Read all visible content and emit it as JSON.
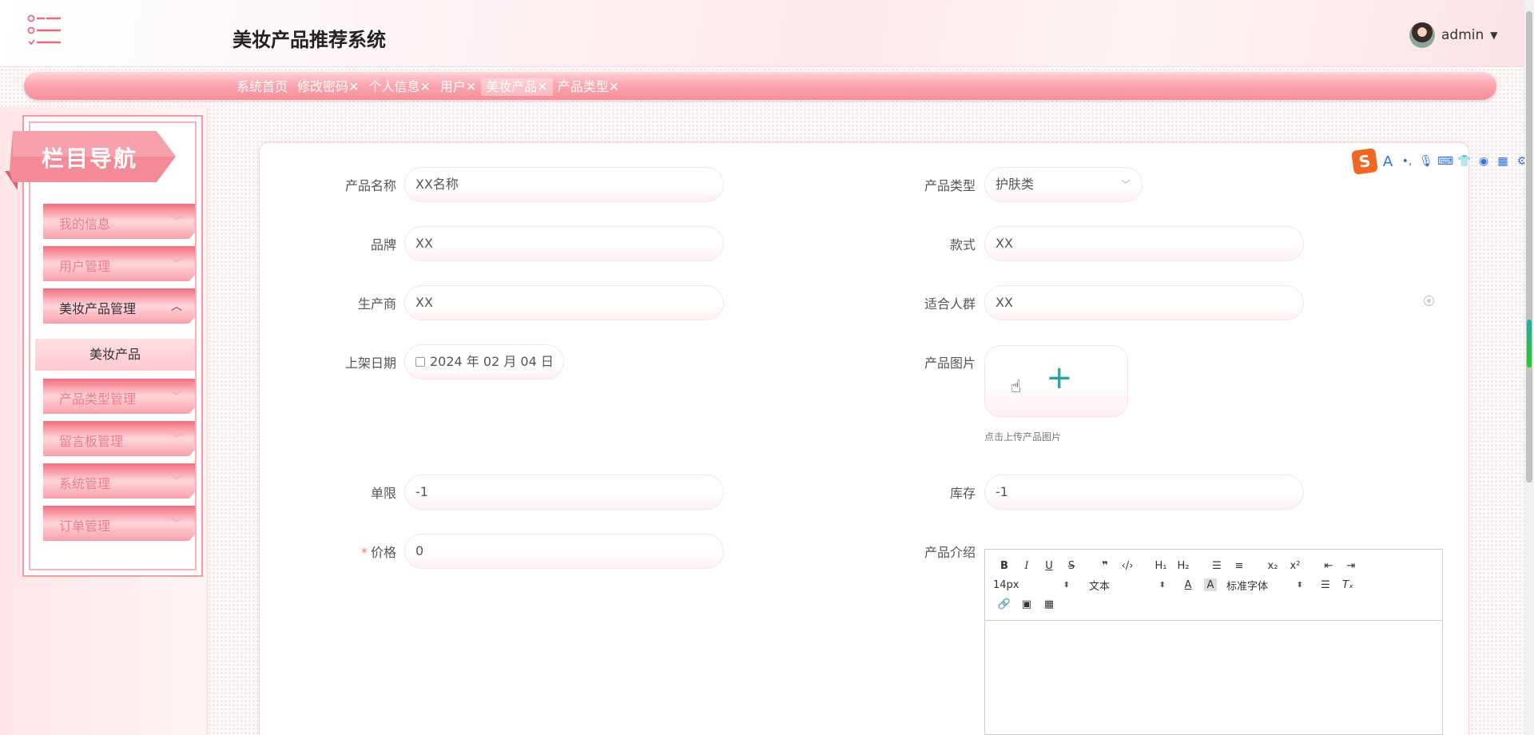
{
  "header": {
    "title": "美妆产品推荐系统",
    "user": "admin"
  },
  "tabs": [
    {
      "label": "系统首页"
    },
    {
      "label": "修改密码✕"
    },
    {
      "label": "个人信息✕"
    },
    {
      "label": "用户✕"
    },
    {
      "label": "美妆产品✕"
    },
    {
      "label": "产品类型✕"
    }
  ],
  "sidebar": {
    "banner": "栏目导航",
    "items": [
      {
        "label": "我的信息"
      },
      {
        "label": "用户管理"
      },
      {
        "label": "美妆产品管理"
      },
      {
        "label": "产品类型管理"
      },
      {
        "label": "留言板管理"
      },
      {
        "label": "系统管理"
      },
      {
        "label": "订单管理"
      }
    ],
    "sub_active": "美妆产品"
  },
  "form": {
    "name_label": "产品名称",
    "name_value": "XX名称",
    "type_label": "产品类型",
    "type_value": "护肤类",
    "brand_label": "品牌",
    "brand_value": "XX",
    "style_label": "款式",
    "style_value": "XX",
    "maker_label": "生产商",
    "maker_value": "XX",
    "crowd_label": "适合人群",
    "crowd_value": "XX",
    "date_label": "上架日期",
    "date_value": "2024 年 02 月 04 日",
    "image_label": "产品图片",
    "upload_tip": "点击上传产品图片",
    "limit_label": "单限",
    "limit_value": "-1",
    "stock_label": "库存",
    "stock_value": "-1",
    "price_req": "*",
    "price_label": "价格",
    "price_value": "0",
    "intro_label": "产品介绍"
  },
  "editor": {
    "font_size": "14px",
    "text_style": "文本",
    "font_family": "标准字体"
  },
  "colors": {
    "accent": "#f58e9a",
    "upload_plus": "#26a69a"
  }
}
